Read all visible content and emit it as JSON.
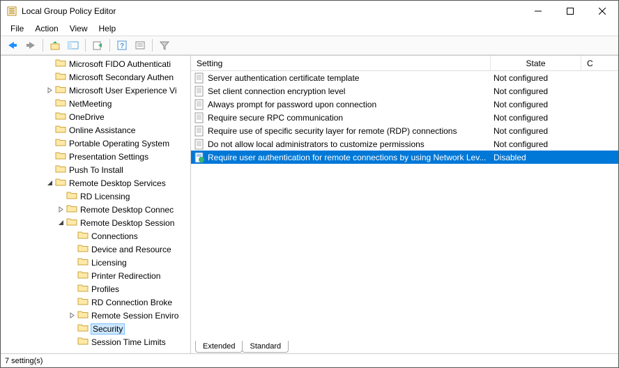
{
  "window": {
    "title": "Local Group Policy Editor"
  },
  "menu": {
    "file": "File",
    "action": "Action",
    "view": "View",
    "help": "Help"
  },
  "tree": {
    "items": [
      {
        "indent": 4,
        "twisty": "",
        "label": "Microsoft FIDO Authenticati"
      },
      {
        "indent": 4,
        "twisty": "",
        "label": "Microsoft Secondary Authen"
      },
      {
        "indent": 4,
        "twisty": "collapsed",
        "label": "Microsoft User Experience Vi"
      },
      {
        "indent": 4,
        "twisty": "",
        "label": "NetMeeting"
      },
      {
        "indent": 4,
        "twisty": "",
        "label": "OneDrive"
      },
      {
        "indent": 4,
        "twisty": "",
        "label": "Online Assistance"
      },
      {
        "indent": 4,
        "twisty": "",
        "label": "Portable Operating System"
      },
      {
        "indent": 4,
        "twisty": "",
        "label": "Presentation Settings"
      },
      {
        "indent": 4,
        "twisty": "",
        "label": "Push To Install"
      },
      {
        "indent": 4,
        "twisty": "expanded",
        "label": "Remote Desktop Services"
      },
      {
        "indent": 5,
        "twisty": "",
        "label": "RD Licensing"
      },
      {
        "indent": 5,
        "twisty": "collapsed",
        "label": "Remote Desktop Connec"
      },
      {
        "indent": 5,
        "twisty": "expanded",
        "label": "Remote Desktop Session"
      },
      {
        "indent": 6,
        "twisty": "",
        "label": "Connections"
      },
      {
        "indent": 6,
        "twisty": "",
        "label": "Device and Resource"
      },
      {
        "indent": 6,
        "twisty": "",
        "label": "Licensing"
      },
      {
        "indent": 6,
        "twisty": "",
        "label": "Printer Redirection"
      },
      {
        "indent": 6,
        "twisty": "",
        "label": "Profiles"
      },
      {
        "indent": 6,
        "twisty": "",
        "label": "RD Connection Broke"
      },
      {
        "indent": 6,
        "twisty": "collapsed",
        "label": "Remote Session Enviro"
      },
      {
        "indent": 6,
        "twisty": "",
        "label": "Security",
        "selected": true
      },
      {
        "indent": 6,
        "twisty": "",
        "label": "Session Time Limits"
      }
    ]
  },
  "grid": {
    "columns": {
      "setting": "Setting",
      "state": "State",
      "comment": "C"
    },
    "rows": [
      {
        "label": "Server authentication certificate template",
        "state": "Not configured",
        "selected": false
      },
      {
        "label": "Set client connection encryption level",
        "state": "Not configured",
        "selected": false
      },
      {
        "label": "Always prompt for password upon connection",
        "state": "Not configured",
        "selected": false
      },
      {
        "label": "Require secure RPC communication",
        "state": "Not configured",
        "selected": false
      },
      {
        "label": "Require use of specific security layer for remote (RDP) connections",
        "state": "Not configured",
        "selected": false
      },
      {
        "label": "Do not allow local administrators to customize permissions",
        "state": "Not configured",
        "selected": false
      },
      {
        "label": "Require user authentication for remote connections by using Network Lev...",
        "state": "Disabled",
        "selected": true
      }
    ]
  },
  "tabs": {
    "extended": "Extended",
    "standard": "Standard"
  },
  "status": {
    "text": "7 setting(s)"
  }
}
